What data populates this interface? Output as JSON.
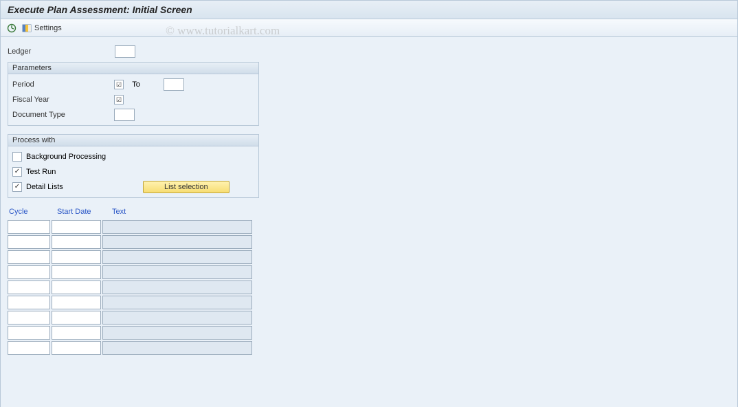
{
  "title": "Execute Plan Assessment: Initial Screen",
  "toolbar": {
    "settings_label": "Settings"
  },
  "watermark": "© www.tutorialkart.com",
  "ledger": {
    "label": "Ledger",
    "value": ""
  },
  "parameters": {
    "title": "Parameters",
    "period_label": "Period",
    "period_from": "",
    "to_label": "To",
    "period_to": "",
    "fiscal_year_label": "Fiscal Year",
    "fiscal_year": "",
    "doc_type_label": "Document Type",
    "doc_type": ""
  },
  "process": {
    "title": "Process with",
    "background_label": "Background Processing",
    "background_checked": false,
    "testrun_label": "Test Run",
    "testrun_checked": true,
    "detail_label": "Detail Lists",
    "detail_checked": true,
    "list_selection_label": "List selection"
  },
  "table": {
    "headers": {
      "cycle": "Cycle",
      "start_date": "Start Date",
      "text": "Text"
    },
    "rows": [
      {
        "cycle": "",
        "start_date": "",
        "text": ""
      },
      {
        "cycle": "",
        "start_date": "",
        "text": ""
      },
      {
        "cycle": "",
        "start_date": "",
        "text": ""
      },
      {
        "cycle": "",
        "start_date": "",
        "text": ""
      },
      {
        "cycle": "",
        "start_date": "",
        "text": ""
      },
      {
        "cycle": "",
        "start_date": "",
        "text": ""
      },
      {
        "cycle": "",
        "start_date": "",
        "text": ""
      },
      {
        "cycle": "",
        "start_date": "",
        "text": ""
      },
      {
        "cycle": "",
        "start_date": "",
        "text": ""
      }
    ]
  }
}
